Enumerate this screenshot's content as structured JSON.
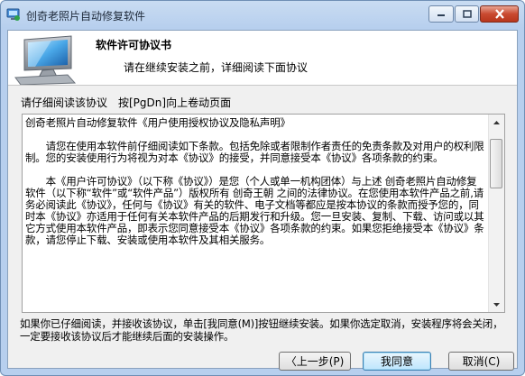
{
  "window": {
    "title": "创奇老照片自动修复软件"
  },
  "header": {
    "title": "软件许可协议书",
    "subtitle": "请在继续安装之前，详细阅读下面协议"
  },
  "instruction": "请仔细阅读该协议　按[PgDn]向上卷动页面",
  "license": {
    "paragraphs": [
      "创奇老照片自动修复软件《用户使用授权协议及隐私声明》",
      "",
      "　　请您在使用本软件前仔细阅读如下条款。包括免除或者限制作者责任的免责条款及对用户的权利限制。您的安装使用行为将视为对本《协议》的接受，并同意接受本《协议》各项条款的约束。",
      "",
      "　　本《用户许可协议》（以下称《协议》）是您（个人或单一机构团体）与上述 创奇老照片自动修复软件（以下称“软件”或“软件产品”）版权所有 创奇王朝 之间的法律协议。在您使用本软件产品之前,请务必阅读此《协议》，任何与《协议》有关的软件、电子文档等都应是按本协议的条款而授予您的，同时本《协议》亦适用于任何有关本软件产品的后期发行和升级。您一旦安装、复制、下载、访问或以其它方式使用本软件产品，即表示您同意接受本《协议》各项条款的约束。如果您拒绝接受本《协议》条款，请您停止下载、安装或使用本软件及其相关服务。"
    ]
  },
  "bottom_text": "如果你已仔细阅读，并接收该协议，单击[我同意(M)]按钮继续安装。如果你选定取消，安装程序将会关闭，一定要接收该协议后才能继续后面的安装操作。",
  "buttons": {
    "back": "〈上一步(P)",
    "agree": "我同意",
    "cancel": "取消(C)"
  },
  "colors": {
    "close_button": "#c94a30",
    "title_bar": "#b7cfee",
    "default_button_border": "#3c7fb1"
  }
}
